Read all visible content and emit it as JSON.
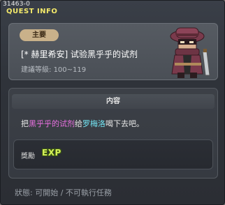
{
  "window": {
    "quest_id": "31463-0",
    "title": "QUEST INFO"
  },
  "quest": {
    "category_tag": "主要",
    "name": "[* 赫里希安] 试验黑乎乎的试剂",
    "level_label": "建議等級:",
    "level_range": "100~119",
    "npc_icon": "npc-ninja-portrait-icon"
  },
  "content": {
    "header": "内容",
    "desc_parts": {
      "prefix": "把",
      "item": "黑乎乎的试剂",
      "middle": "给",
      "npc": "罗梅洛",
      "suffix": "喝下去吧。"
    },
    "reward_label": "獎勵",
    "reward_icon_text": "EXP"
  },
  "status": {
    "text": "狀態: 可開始 / 不可執行任務"
  },
  "colors": {
    "title": "#f4e96a",
    "item_highlight": "#e870e0",
    "npc_highlight": "#72e2f0",
    "exp": "#d6f25a"
  }
}
